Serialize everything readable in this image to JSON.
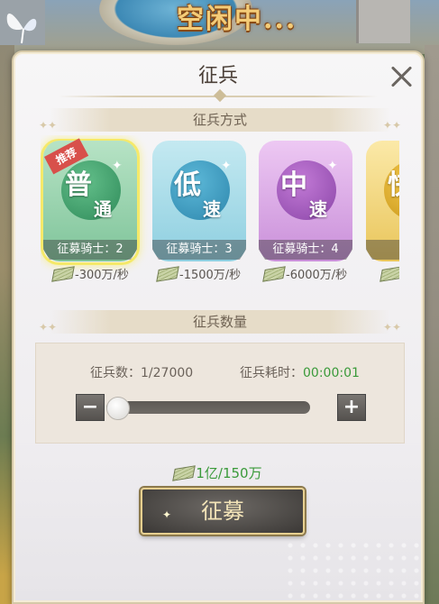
{
  "status_banner": "空闲中...",
  "dialog": {
    "title": "征兵",
    "close_icon": "close-icon"
  },
  "method_section": {
    "title": "征兵方式"
  },
  "cards": [
    {
      "id": "normal",
      "big": "普",
      "small": "通",
      "knights": "征募骑士：2",
      "cost": "-300万/秒",
      "color": "green",
      "badge": "推荐",
      "selected": true
    },
    {
      "id": "low",
      "big": "低",
      "small": "速",
      "knights": "征募骑士：3",
      "cost": "-1500万/秒",
      "color": "blue"
    },
    {
      "id": "mid",
      "big": "中",
      "small": "速",
      "knights": "征募骑士：4",
      "cost": "-6000万/秒",
      "color": "purple"
    },
    {
      "id": "high",
      "big": "快",
      "small": "",
      "knights": "征募",
      "cost": "",
      "color": "gold"
    }
  ],
  "quantity_section": {
    "title": "征兵数量",
    "count_label": "征兵数：",
    "count_value": "1/27000",
    "time_label": "征兵耗时：",
    "time_value": "00:00:01",
    "slider_value": 1,
    "slider_max": 27000,
    "minus_label": "−",
    "plus_label": "+"
  },
  "total_cost": "1亿/150万",
  "recruit_button": "征募",
  "colors": {
    "green_text": "#3a9a3a",
    "badge_red": "#d8504b",
    "button_gold": "#e6cf8f"
  }
}
